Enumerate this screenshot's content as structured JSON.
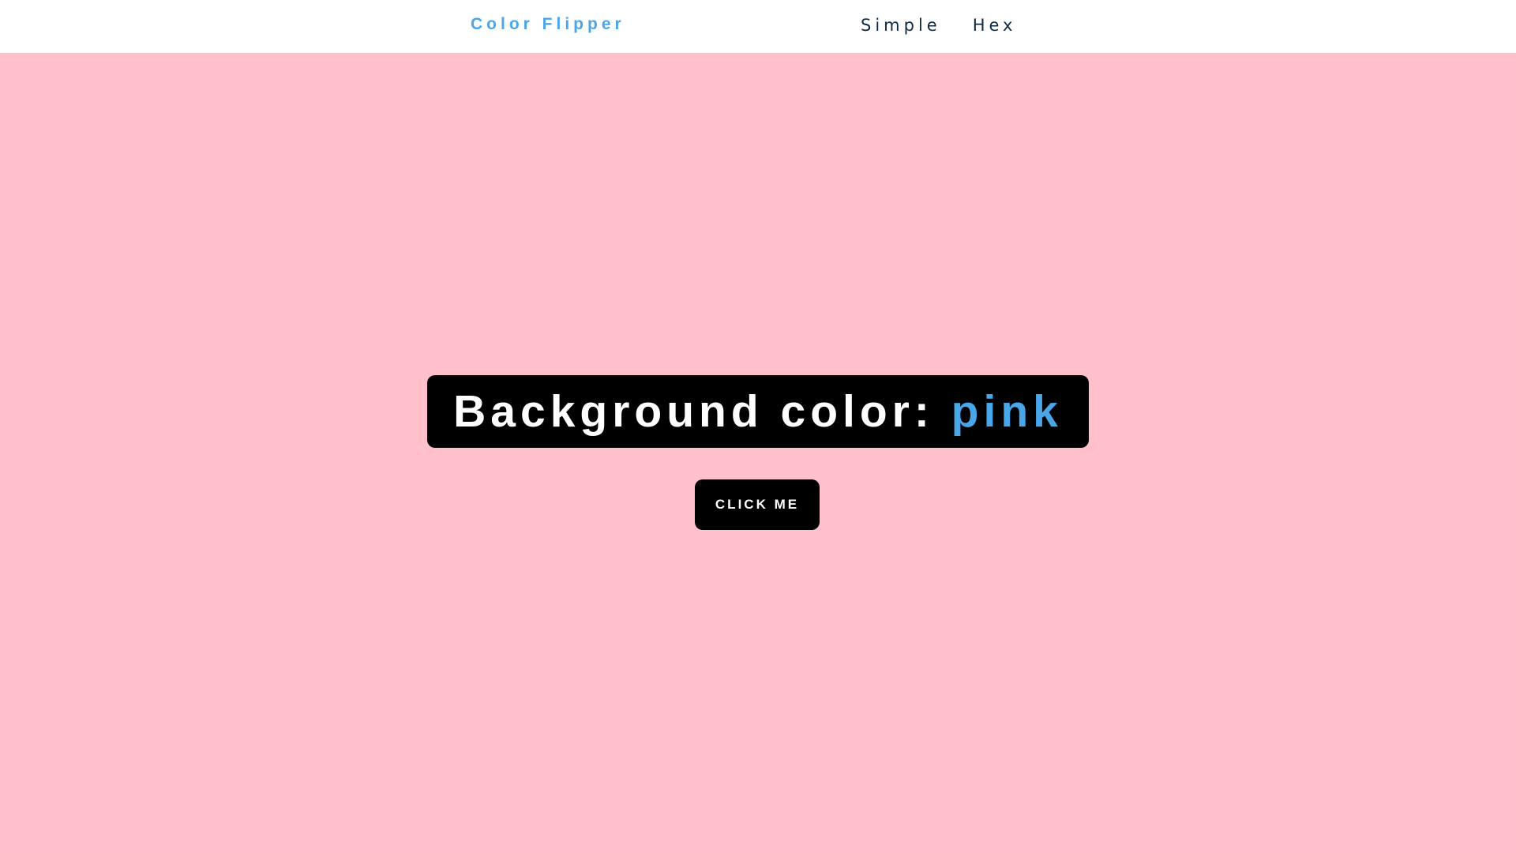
{
  "nav": {
    "brand": "Color Flipper",
    "links": [
      "Simple",
      "Hex"
    ]
  },
  "main": {
    "heading_prefix": "Background color: ",
    "color_name": "pink",
    "button_label": "CLICK ME"
  },
  "colors": {
    "background": "#ffc0cb",
    "accent": "#49a6e9",
    "nav_text": "#102a42"
  }
}
